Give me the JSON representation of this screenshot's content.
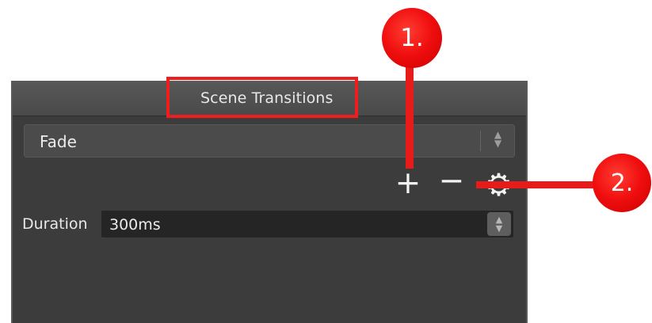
{
  "panel": {
    "title": "Scene Transitions"
  },
  "transition_select": {
    "selected": "Fade",
    "arrows": "▲\n▼"
  },
  "toolbar": {
    "add_symbol": "+",
    "remove_symbol": "−",
    "settings_symbol": "⚙"
  },
  "duration": {
    "label": "Duration",
    "value": "300ms",
    "arrows": "▲\n▼"
  },
  "annotations": {
    "marker_1": "1.",
    "marker_2": "2."
  },
  "colors": {
    "panel_background": "#3c3c3c",
    "header_background": "#4f4f4f",
    "input_background": "#252525",
    "annotation_red": "#ef1d1d",
    "text": "#e8e8e8"
  },
  "icons": {
    "add": "plus-icon",
    "remove": "minus-icon",
    "settings": "gear-icon",
    "select_arrows": "chevron-up-down-icon",
    "duration_arrows": "stepper-up-down-icon"
  }
}
